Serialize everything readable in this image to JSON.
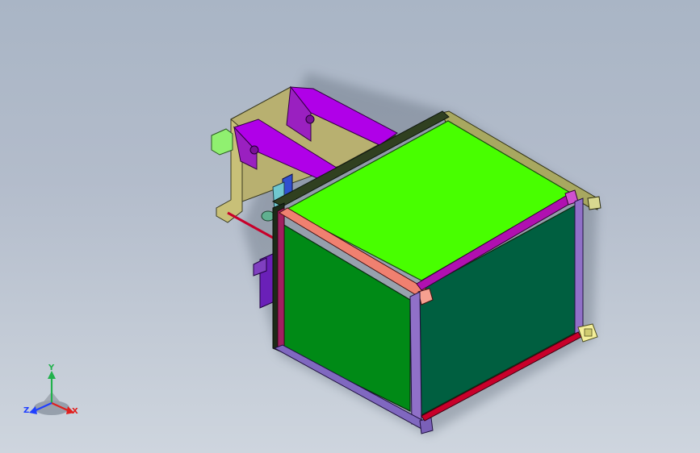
{
  "view": {
    "background_top": "#a9b5c5",
    "background_bottom": "#ced5de"
  },
  "triad": {
    "x_label": "X",
    "y_label": "Y",
    "z_label": "Z",
    "x_color": "#e0201e",
    "y_color": "#22b14c",
    "z_color": "#2040ff"
  },
  "model": {
    "top_panel_color": "#48ff00",
    "front_panel_color": "#008a16",
    "side_panel_color": "#005f40",
    "frame_magenta": "#b010b0",
    "frame_salmon": "#f08070",
    "frame_lavender": "#9070c8",
    "frame_olive": "#a8a860",
    "bracket_purple": "#b000e8",
    "bracket_khaki": "#c8c078",
    "accent_red": "#c8002a",
    "accent_yellow": "#f4ef9a",
    "accent_lightgreen": "#90f070"
  }
}
